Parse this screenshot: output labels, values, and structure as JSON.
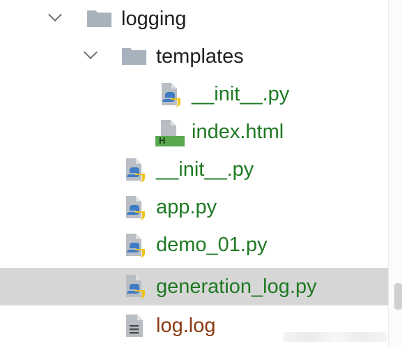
{
  "tree": {
    "items": [
      {
        "label": "logging",
        "kind": "folder",
        "expanded": true
      },
      {
        "label": "templates",
        "kind": "folder",
        "expanded": true
      },
      {
        "label": "__init__.py",
        "kind": "python-file"
      },
      {
        "label": "index.html",
        "kind": "html-file"
      },
      {
        "label": "__init__.py",
        "kind": "python-file"
      },
      {
        "label": "app.py",
        "kind": "python-file"
      },
      {
        "label": "demo_01.py",
        "kind": "python-file"
      },
      {
        "label": "generation_log.py",
        "kind": "python-file",
        "selected": true
      },
      {
        "label": "log.log",
        "kind": "text-file"
      }
    ]
  },
  "icons": {
    "folder": "folder-icon",
    "python_file": "python-file-icon",
    "html_file": "html-file-icon",
    "text_file": "text-file-icon",
    "expand": "chevron-down-icon"
  },
  "html_badge": "H",
  "colors": {
    "folder_text": "#1f1f1f",
    "python_text": "#1e7a22",
    "log_text": "#8a3a12",
    "selection": "#d6d6d6",
    "python_blue": "#3f7cc3",
    "python_yellow": "#f0c419",
    "html_green": "#5aa84f"
  }
}
